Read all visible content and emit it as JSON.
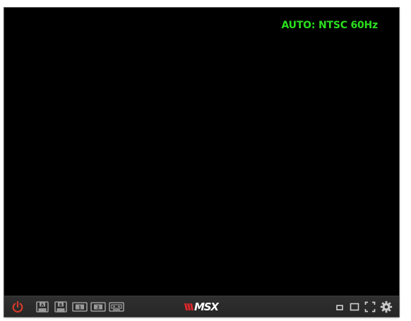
{
  "screen": {
    "osd_text": "AUTO: NTSC 60Hz"
  },
  "colors": {
    "osd_green": "#2adf1e",
    "power_red": "#d63a2a",
    "logo_red": "#d8272b",
    "icon_gray": "#9a9a9a"
  },
  "toolbar": {
    "left_buttons": [
      {
        "name": "power-icon"
      },
      {
        "name": "floppy-drive-a-icon",
        "label": "A"
      },
      {
        "name": "floppy-drive-b-icon",
        "label": "B"
      },
      {
        "name": "cartridge-slot-1-icon",
        "label": "1"
      },
      {
        "name": "cartridge-slot-2-icon",
        "label": "2"
      },
      {
        "name": "cassette-tape-icon"
      }
    ],
    "logo": {
      "brand_text": "MSX"
    },
    "right_buttons": [
      {
        "name": "small-window-icon"
      },
      {
        "name": "medium-window-icon"
      },
      {
        "name": "fullscreen-icon"
      },
      {
        "name": "settings-gear-icon"
      }
    ]
  }
}
